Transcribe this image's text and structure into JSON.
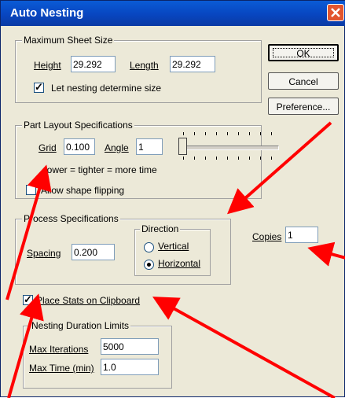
{
  "title": "Auto Nesting",
  "max_sheet": {
    "title": "Maximum Sheet Size",
    "height_label": "Height",
    "height_value": "29.292",
    "length_label": "Length",
    "length_value": "29.292",
    "let_nesting_label": "Let nesting determine size",
    "let_nesting_checked": true
  },
  "buttons": {
    "ok": "OK",
    "cancel": "Cancel",
    "preference": "Preference..."
  },
  "part_layout": {
    "title": "Part Layout Specifications",
    "grid_label": "Grid",
    "grid_value": "0.100",
    "angle_label": "Angle",
    "angle_value": "1",
    "hint": "lower = tighter = more time",
    "allow_flip_label": "Allow shape flipping",
    "allow_flip_checked": false,
    "slider_fraction": 0.0
  },
  "process": {
    "title": "Process Specifications",
    "spacing_label": "Spacing",
    "spacing_value": "0.200",
    "direction_title": "Direction",
    "vertical_label": "Vertical",
    "horizontal_label": "Horizontal",
    "selected": "horizontal"
  },
  "copies": {
    "label": "Copies",
    "value": "1"
  },
  "stats": {
    "label": "Place Stats on Clipboard",
    "checked": true
  },
  "duration": {
    "title": "Nesting Duration Limits",
    "iter_label": "Max Iterations",
    "iter_value": "5000",
    "time_label": "Max Time (min)",
    "time_value": "1.0"
  },
  "colors": {
    "annotation_arrow": "#ff0000",
    "titlebar": "#0a5bd6"
  }
}
